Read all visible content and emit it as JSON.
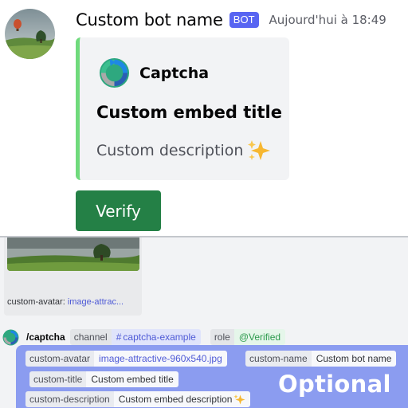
{
  "message": {
    "username": "Custom bot name",
    "bot_tag": "BOT",
    "timestamp": "Aujourd'hui à 18:49",
    "embed": {
      "author": "Captcha",
      "title": "Custom embed title",
      "description": "Custom description",
      "description_emoji": "sparkles-icon",
      "accent_color": "#6fda7c"
    },
    "button": {
      "label": "Verify",
      "color": "#248046"
    }
  },
  "attachment": {
    "key": "custom-avatar:",
    "value": "image-attrac..."
  },
  "command": {
    "name": "/captcha",
    "options": [
      {
        "key": "channel",
        "value": "captcha-example",
        "prefix": "#"
      },
      {
        "key": "role",
        "value": "@Verified"
      }
    ]
  },
  "optional_box": {
    "label": "Optional",
    "color": "#8b9cf0",
    "options": [
      {
        "key": "custom-avatar",
        "value": "image-attractive-960x540.jpg"
      },
      {
        "key": "custom-name",
        "value": "Custom bot name"
      },
      {
        "key": "custom-title",
        "value": "Custom embed title"
      },
      {
        "key": "custom-description",
        "value": "Custom embed description"
      }
    ]
  }
}
